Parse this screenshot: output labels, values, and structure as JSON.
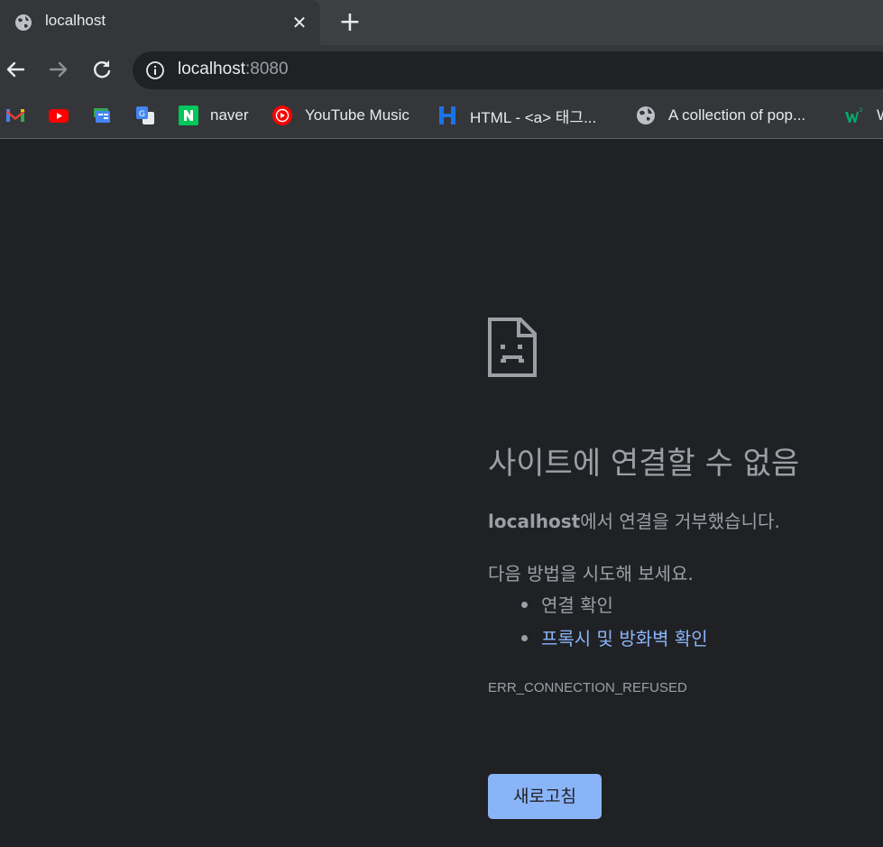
{
  "tab": {
    "title": "localhost",
    "close_glyph": "✕",
    "new_tab_glyph": "+"
  },
  "omnibox": {
    "host": "localhost",
    "port": ":8080"
  },
  "bookmarks": [
    {
      "label": "",
      "icon": "gmail-icon"
    },
    {
      "label": "",
      "icon": "youtube-icon"
    },
    {
      "label": "",
      "icon": "google-news-icon"
    },
    {
      "label": "",
      "icon": "google-translate-icon"
    },
    {
      "label": "naver",
      "icon": "naver-icon"
    },
    {
      "label": "YouTube Music",
      "icon": "youtube-music-icon"
    },
    {
      "label": "HTML - <a> 태그...",
      "icon": "h-icon"
    },
    {
      "label": "A collection of pop...",
      "icon": "globe-icon"
    },
    {
      "label": "W",
      "icon": "w3-icon"
    }
  ],
  "error": {
    "title": "사이트에 연결할 수 없음",
    "host": "localhost",
    "message": "에서 연결을 거부했습니다.",
    "suggest_heading": "다음 방법을 시도해 보세요.",
    "suggestion_1": "연결 확인",
    "suggestion_2": "프록시 및 방화벽 확인",
    "code": "ERR_CONNECTION_REFUSED",
    "reload_label": "새로고침"
  },
  "colors": {
    "page_bg": "#202124",
    "text_muted": "#9aa0a6",
    "link": "#8ab4f8",
    "button_bg": "#8ab4f8"
  }
}
